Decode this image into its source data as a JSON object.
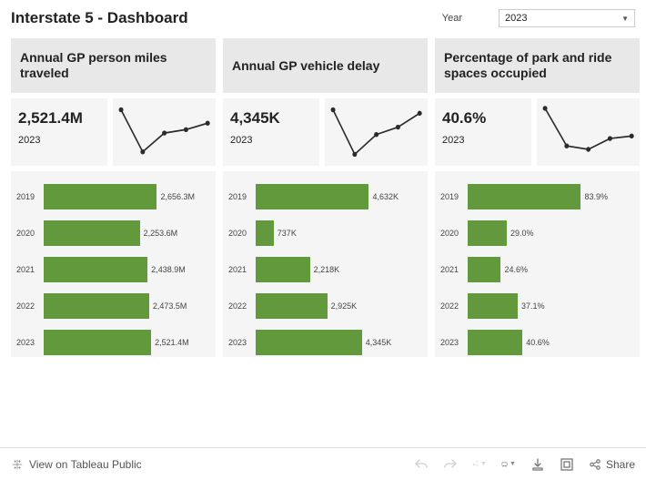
{
  "title": "Interstate 5 - Dashboard",
  "year_picker": {
    "label": "Year",
    "value": "2023"
  },
  "panels": [
    {
      "header": "Annual GP person miles traveled",
      "kpi_value": "2,521.4M",
      "kpi_year": "2023",
      "spark": {
        "pts": [
          [
            0,
            0.05
          ],
          [
            0.25,
            0.9
          ],
          [
            0.5,
            0.52
          ],
          [
            0.75,
            0.45
          ],
          [
            1,
            0.32
          ]
        ]
      },
      "max": 2656.3,
      "bars": [
        {
          "year": "2019",
          "label": "2,656.3M",
          "v": 2656.3
        },
        {
          "year": "2020",
          "label": "2,253.6M",
          "v": 2253.6
        },
        {
          "year": "2021",
          "label": "2,438.9M",
          "v": 2438.9
        },
        {
          "year": "2022",
          "label": "2,473.5M",
          "v": 2473.5
        },
        {
          "year": "2023",
          "label": "2,521.4M",
          "v": 2521.4
        }
      ]
    },
    {
      "header": "Annual GP vehicle delay",
      "kpi_value": "4,345K",
      "kpi_year": "2023",
      "spark": {
        "pts": [
          [
            0,
            0.05
          ],
          [
            0.25,
            0.95
          ],
          [
            0.5,
            0.55
          ],
          [
            0.75,
            0.4
          ],
          [
            1,
            0.12
          ]
        ]
      },
      "max": 4632,
      "bars": [
        {
          "year": "2019",
          "label": "4,632K",
          "v": 4632
        },
        {
          "year": "2020",
          "label": "737K",
          "v": 737
        },
        {
          "year": "2021",
          "label": "2,218K",
          "v": 2218
        },
        {
          "year": "2022",
          "label": "2,925K",
          "v": 2925
        },
        {
          "year": "2023",
          "label": "4,345K",
          "v": 4345
        }
      ]
    },
    {
      "header": "Percentage of park and ride spaces occupied",
      "kpi_value": "40.6%",
      "kpi_year": "2023",
      "spark": {
        "pts": [
          [
            0,
            0.02
          ],
          [
            0.25,
            0.78
          ],
          [
            0.5,
            0.85
          ],
          [
            0.75,
            0.63
          ],
          [
            1,
            0.58
          ]
        ]
      },
      "max": 83.9,
      "bars": [
        {
          "year": "2019",
          "label": "83.9%",
          "v": 83.9
        },
        {
          "year": "2020",
          "label": "29.0%",
          "v": 29.0
        },
        {
          "year": "2021",
          "label": "24.6%",
          "v": 24.6
        },
        {
          "year": "2022",
          "label": "37.1%",
          "v": 37.1
        },
        {
          "year": "2023",
          "label": "40.6%",
          "v": 40.6
        }
      ]
    }
  ],
  "footer": {
    "view_label": "View on Tableau Public",
    "share_label": "Share"
  },
  "chart_data": [
    {
      "type": "bar",
      "title": "Annual GP person miles traveled",
      "categories": [
        "2019",
        "2020",
        "2021",
        "2022",
        "2023"
      ],
      "values": [
        2656.3,
        2253.6,
        2438.9,
        2473.5,
        2521.4
      ],
      "unit": "M",
      "xlabel": "",
      "ylabel": "",
      "ylim": [
        0,
        2656.3
      ]
    },
    {
      "type": "bar",
      "title": "Annual GP vehicle delay",
      "categories": [
        "2019",
        "2020",
        "2021",
        "2022",
        "2023"
      ],
      "values": [
        4632,
        737,
        2218,
        2925,
        4345
      ],
      "unit": "K",
      "xlabel": "",
      "ylabel": "",
      "ylim": [
        0,
        4632
      ]
    },
    {
      "type": "bar",
      "title": "Percentage of park and ride spaces occupied",
      "categories": [
        "2019",
        "2020",
        "2021",
        "2022",
        "2023"
      ],
      "values": [
        83.9,
        29.0,
        24.6,
        37.1,
        40.6
      ],
      "unit": "%",
      "xlabel": "",
      "ylabel": "",
      "ylim": [
        0,
        83.9
      ]
    }
  ]
}
